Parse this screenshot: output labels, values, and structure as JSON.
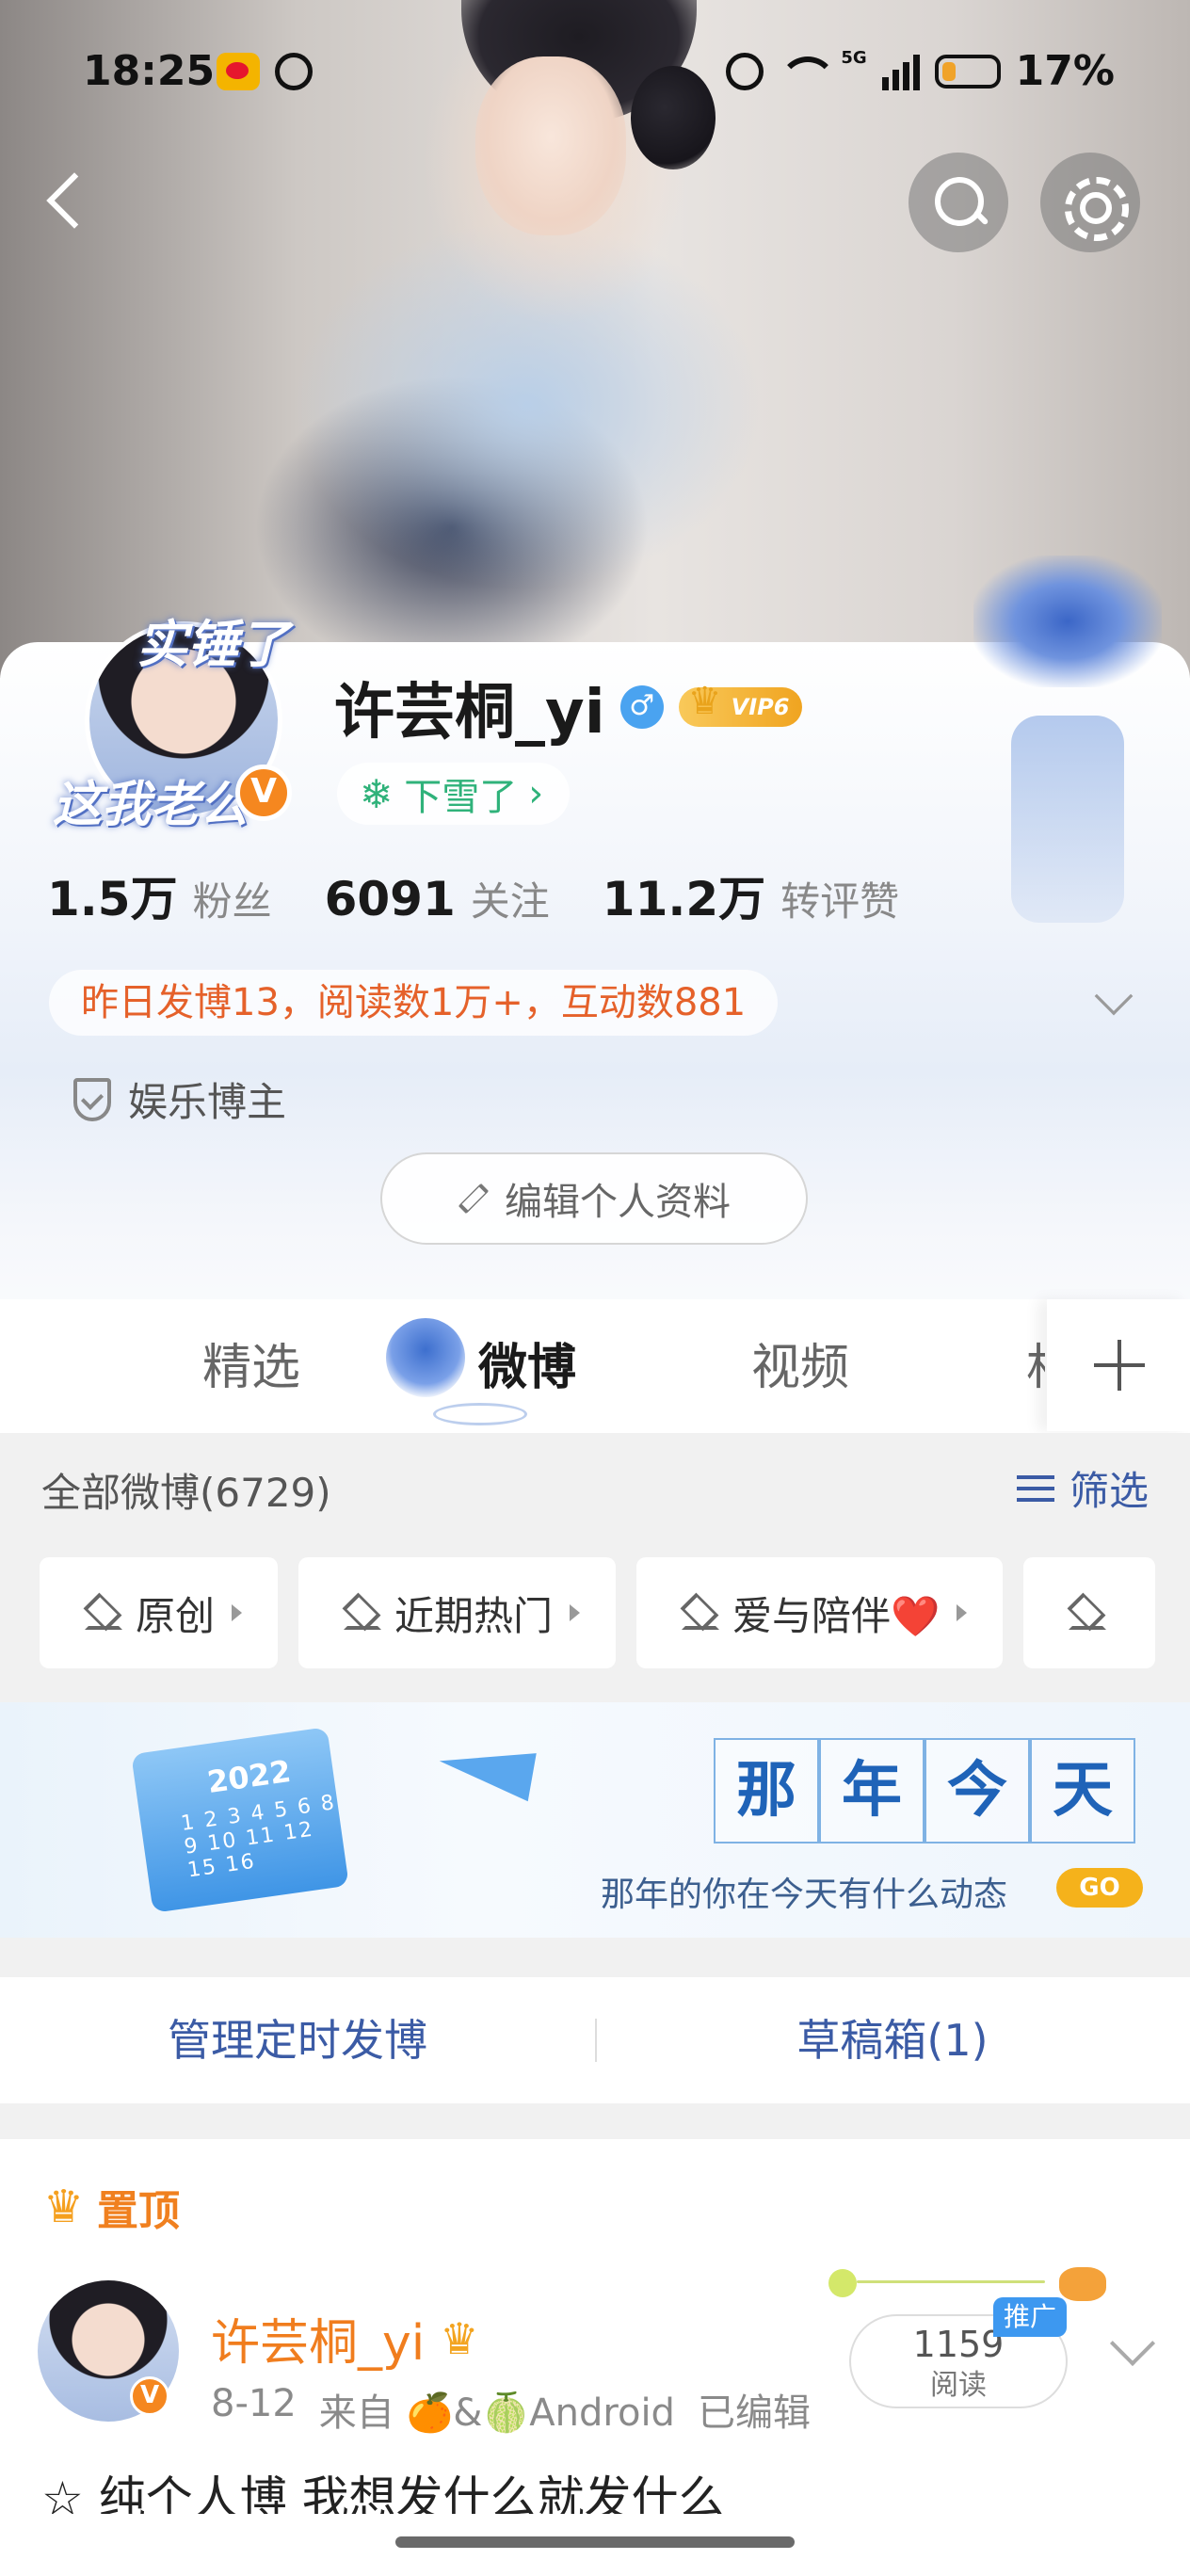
{
  "status_bar": {
    "time": "18:25",
    "network": "5G",
    "battery": "17%"
  },
  "profile": {
    "avatar_frame_top": "实锤了",
    "avatar_frame_bottom": "这我老公",
    "verify_mark": "V",
    "username": "许芸桐_yi",
    "gender_mark": "♂",
    "vip_level": "VIP6",
    "status": "下雪了",
    "status_arrow": "›",
    "stats": [
      {
        "value": "1.5万",
        "label": "粉丝"
      },
      {
        "value": "6091",
        "label": "关注"
      },
      {
        "value": "11.2万",
        "label": "转评赞"
      }
    ],
    "summary": "昨日发博13，阅读数1万+，互动数881",
    "blogger_type": "娱乐博主",
    "edit_profile": "编辑个人资料"
  },
  "tabs": {
    "items": [
      "精选",
      "微博",
      "视频",
      "相"
    ],
    "active": "微博"
  },
  "filter": {
    "all_count": "全部微博(6729)",
    "filter_label": "筛选",
    "chips": [
      "原创",
      "近期热门",
      "爱与陪伴❤️"
    ]
  },
  "banner": {
    "year": "2022",
    "calendar_days": "1 2 3 4 5 6 8 9 10 11 12 15 16",
    "title_chars": [
      "那",
      "年",
      "今",
      "天"
    ],
    "subtitle": "那年的你在今天有什么动态",
    "go": "GO"
  },
  "manage": {
    "scheduled": "管理定时发博",
    "drafts": "草稿箱(1)"
  },
  "post": {
    "pinned_label": "置顶",
    "author": "许芸桐_yi",
    "date": "8-12",
    "source": "来自 🍊&🍈Android",
    "edited": "已编辑",
    "read_count": "1159",
    "read_label": "阅读",
    "promo_tag": "推广",
    "text": "☆ 纯个人博 我想发什么就发什么"
  },
  "colors": {
    "accent_orange": "#f07d1e",
    "link_blue": "#3b5ba5",
    "status_green": "#2fb27a",
    "summary_orange": "#e5612a"
  }
}
